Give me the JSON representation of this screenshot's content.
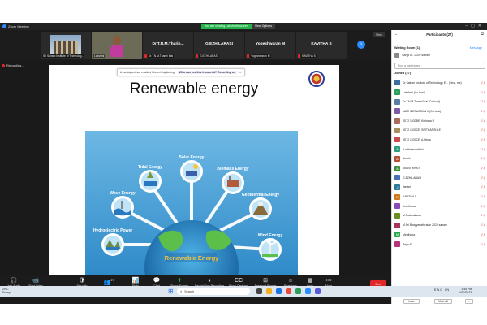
{
  "window": {
    "title": "Zoom Meeting"
  },
  "banner": {
    "message": "You are viewing Lakshmi's screen",
    "options": "View Options"
  },
  "gallery": [
    {
      "name": "",
      "caption": "Sri Sairam Institute of Technolog...",
      "kind": "photo"
    },
    {
      "name": "",
      "caption": "Lakshmi",
      "kind": "video"
    },
    {
      "name": "Dr.T.N.M.Tharin...",
      "caption": "Dr.T.N.M.Tharini Mai"
    },
    {
      "name": "G.EZHILARASI",
      "caption": "G.EZHILARASI"
    },
    {
      "name": "Yogeshwaran M",
      "caption": "Yogeshwaran M"
    },
    {
      "name": "KAVITHA S",
      "caption": "KAVITHA S"
    }
  ],
  "view_button": "View",
  "recording_label": "Recording...",
  "caption_banner": {
    "text": "A participant has enabled Closed Captioning",
    "cta": "Who can see this transcript? Recording on"
  },
  "slide": {
    "title": "Renewable energy",
    "footer_left": "4.4.22 - ??????",
    "footer_right": "3",
    "center_label": "Renewable Energy",
    "sources": [
      {
        "label": "Solar Energy"
      },
      {
        "label": "Tidal Energy"
      },
      {
        "label": "Biomass Energy"
      },
      {
        "label": "Wave Energy"
      },
      {
        "label": "Geothermal Energy"
      },
      {
        "label": "Hydroelectric Power"
      },
      {
        "label": "Wind Energy"
      }
    ]
  },
  "toolbar": {
    "items": [
      {
        "label": "Join Audio",
        "icon": "headphones-icon",
        "glyph": "🎧"
      },
      {
        "label": "Start Video",
        "icon": "video-off-icon",
        "glyph": "📹"
      },
      {
        "label": "Security",
        "icon": "shield-icon",
        "glyph": "🛡"
      },
      {
        "label": "Participants",
        "icon": "people-icon",
        "glyph": "👥"
      },
      {
        "label": "Polls",
        "icon": "poll-icon",
        "glyph": "📊"
      },
      {
        "label": "Chat",
        "icon": "chat-icon",
        "glyph": "💬"
      },
      {
        "label": "Share Screen",
        "icon": "share-screen-icon",
        "glyph": "⬆"
      },
      {
        "label": "Pause/Stop Recording",
        "icon": "record-icon",
        "glyph": "⏸"
      },
      {
        "label": "Show Captions",
        "icon": "cc-icon",
        "glyph": "CC"
      },
      {
        "label": "Breakout Rooms",
        "icon": "breakout-icon",
        "glyph": "⊞"
      },
      {
        "label": "Reactions",
        "icon": "reaction-icon",
        "glyph": "☺"
      },
      {
        "label": "Apps",
        "icon": "apps-icon",
        "glyph": "▦"
      },
      {
        "label": "More",
        "icon": "more-icon",
        "glyph": "•••"
      }
    ],
    "participants_count": "27",
    "end_label": "End"
  },
  "participants": {
    "title": "Participants (27)",
    "waiting_room": "Waiting Room (1)",
    "message_label": "Message",
    "waiting_name": "Sangi A - 2020 sairam",
    "search_placeholder": "Find a participant",
    "joined_label": "Joined (27)",
    "list": [
      {
        "initial": "",
        "name": "Dr Sairam Institute of Technology E... (Host, me)",
        "status": "",
        "color": "#3a6ea5"
      },
      {
        "initial": "L",
        "name": "Lakshmi (Co-host)",
        "status": "",
        "color": "#2a9d5a"
      },
      {
        "initial": "",
        "name": "Dr.T.N.M.Tharini Mai (Co-host)",
        "status": "",
        "color": "#5a7da8"
      },
      {
        "initial": "",
        "name": "VAITHEESWARAN K (Co-host)",
        "status": "",
        "color": "#7d5aa8"
      },
      {
        "initial": "",
        "name": "[SIT2 1933BE] Kirthana R",
        "status": "",
        "color": "#a86a5a"
      },
      {
        "initial": "",
        "name": "[SIT2 1933CE] SRITHARSHLE",
        "status": "",
        "color": "#a8905a"
      },
      {
        "initial": "",
        "name": "[SIT2 1933CE] A.Divya",
        "status": "",
        "color": "#c94a4a"
      },
      {
        "initial": "A",
        "name": "A.ruthinavardhini",
        "status": "",
        "color": "#2f9e7e"
      },
      {
        "initial": "A",
        "name": "Anush",
        "status": "",
        "color": "#b64f2f"
      },
      {
        "initial": "A",
        "name": "AVANTHIKA S",
        "status": "",
        "color": "#3a8f3a"
      },
      {
        "initial": "",
        "name": "G.EZHILARASI",
        "status": "",
        "color": "#4a6fb6"
      },
      {
        "initial": "J",
        "name": "Janani",
        "status": "",
        "color": "#2a7a9d"
      },
      {
        "initial": "K",
        "name": "KAVITHA S",
        "status": "",
        "color": "#cc7a1a"
      },
      {
        "initial": "",
        "name": "Keerthana",
        "status": "",
        "color": "#8a4ab6"
      },
      {
        "initial": "",
        "name": "M.Prabhakaran",
        "status": "",
        "color": "#6b8e23"
      },
      {
        "initial": "",
        "name": "M.Sri Bhagyavathiratan 2020 sairam",
        "status": "",
        "color": "#a8345a"
      },
      {
        "initial": "M",
        "name": "Mehthoba",
        "status": "",
        "color": "#2aa84a"
      },
      {
        "initial": "",
        "name": "Priya.S",
        "status": "",
        "color": "#b6327a"
      }
    ],
    "invite_label": "Invite",
    "mute_all_label": "Mute All",
    "more_label": "..."
  },
  "taskbar": {
    "weather_temp": "29°C",
    "weather_desc": "Sunny",
    "search_label": "Search",
    "tray": "ENG IN",
    "time": "3:45 PM",
    "date": "4/12/2023"
  }
}
